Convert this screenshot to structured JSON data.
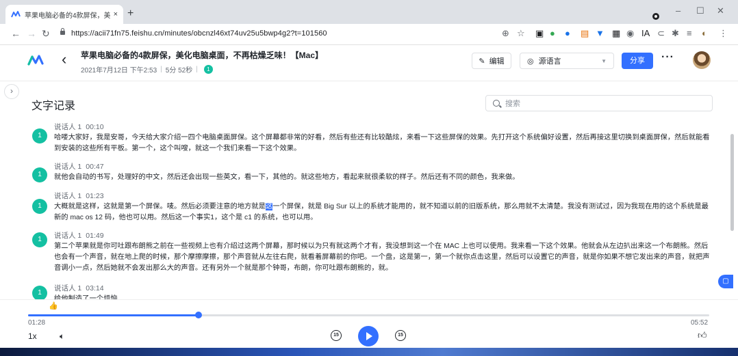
{
  "browser": {
    "tab_title": "苹果电脑必备的4款屏保，美化电…",
    "tab_close": "×",
    "new_tab": "+",
    "url": "https://acii71fn75.feishu.cn/minutes/obcnzl46xt74uv25u5bwp4g2?t=101560",
    "window_controls": [
      "–",
      "☐",
      "✕"
    ],
    "extension_icons": [
      {
        "name": "zoom-icon",
        "glyph": "⊕",
        "color": "#5f6368"
      },
      {
        "name": "bookmark-star-icon",
        "glyph": "☆",
        "color": "#5f6368"
      },
      {
        "name": "extension-ext1-icon",
        "glyph": "▣",
        "color": "#202124"
      },
      {
        "name": "extension-ext2-icon",
        "glyph": "●",
        "color": "#34a853"
      },
      {
        "name": "extension-ext3-icon",
        "glyph": "●",
        "color": "#1a73e8"
      },
      {
        "name": "extension-ext4-icon",
        "glyph": "▤",
        "color": "#e8710a"
      },
      {
        "name": "extension-ext5-icon",
        "glyph": "▼",
        "color": "#1a73e8"
      },
      {
        "name": "extension-ext6-icon",
        "glyph": "▦",
        "color": "#202124"
      },
      {
        "name": "extension-ext7-icon",
        "glyph": "◉",
        "color": "#5f6368"
      },
      {
        "name": "extension-ext8-icon",
        "glyph": "IA",
        "color": "#202124"
      },
      {
        "name": "extension-ext9-icon",
        "glyph": "⊂",
        "color": "#5f6368"
      },
      {
        "name": "extensions-puzzle-icon",
        "glyph": "✱",
        "color": "#5f6368"
      },
      {
        "name": "reading-list-icon",
        "glyph": "≡",
        "color": "#5f6368"
      },
      {
        "name": "profile-icon",
        "glyph": "◐",
        "color": "#8a6d3b"
      },
      {
        "name": "menu-kebab-icon",
        "glyph": "⋮",
        "color": "#5f6368"
      }
    ]
  },
  "header": {
    "title": "苹果电脑必备的4款屏保，美化电脑桌面，不再枯燥乏味！【Mac】",
    "date": "2021年7月12日 下午2:53",
    "duration": "5分 52秒",
    "participant_count": "1",
    "edit_label": "编辑",
    "language_label": "源语言",
    "share_label": "分享",
    "more": "···"
  },
  "transcript": {
    "title": "文字记录",
    "search_placeholder": "搜索",
    "segments": [
      {
        "avatar": "1",
        "speaker": "说话人 1",
        "time": "00:10",
        "text": "哈喽大家好，我是安哥，今天给大家介绍一四个电脑桌面屏保。这个屏幕都非常的好看，然后有些还有比较酷炫，来看一下这些屏保的效果。先打开这个系统偏好设置，然后再接这里切换到桌面屏保，然后就能看到安装的这些所有平板。第一个，这个叫嗖，就这一个我们来看一下这个效果。"
      },
      {
        "avatar": "1",
        "speaker": "说话人 1",
        "time": "00:47",
        "text": "就他会自动的书写，处理好的中文，然后还会出现一些英文，看一下，其他的。就这些地方，看起来就很柔软的样子。然后还有不同的颜色，我来做。"
      },
      {
        "avatar": "1",
        "speaker": "说话人 1",
        "time": "01:23",
        "text_before": "大概就是这样，这就是第一个屏保。唛。然后必须要注意的地方就是",
        "text_highlight": "这",
        "text_after": "一个屏保，就是 Big Sur 以上的系统才能用的，就不知道以前的旧版系统，那么用就不太清楚。我没有测试过，因为我现在用的这个系统是最新的  mac  os  12 码，他也可以用。然后这一个事实1，这个是  c1 的系统，也可以用。"
      },
      {
        "avatar": "1",
        "speaker": "说话人 1",
        "time": "01:49",
        "text": "第二个苹果就是你可吐跟布朗熊之前在一些视频上也有介绍过这两个屏幕，那时候以为只有就这两个才有，我没想到这一个在 MAC 上也可以使用。我来看一下这个效果。他就会从左边扒出来这一个布朗熊。然后也会有一个声音，就在地上爬的时候，那个摩擦摩擦，那个声音就从左往右爬，就看着屏幕前的你吧。一个盘，这是第一，第一个就你点击这里，然后可以设置它的声音，就是你如果不想它发出来的声音，就把声音调小一点，然后她就不会发出那么大的声音。还有另外一个就是那个钟哥，布朗，你可吐跟布朗熊的，就。"
      },
      {
        "avatar": "1",
        "speaker": "说话人 1",
        "time": "03:14",
        "text": "给他制造了一个烦恼"
      }
    ]
  },
  "player": {
    "current_time": "01:28",
    "total_time": "05:52",
    "progress": 0.25,
    "speed": "1x",
    "skip_back": "15",
    "skip_forward": "15",
    "reaction_emoji": "👍"
  },
  "colors": {
    "accent": "#3370ff",
    "speaker": "#14c0a2",
    "tabstrip": "#dee1e6"
  }
}
